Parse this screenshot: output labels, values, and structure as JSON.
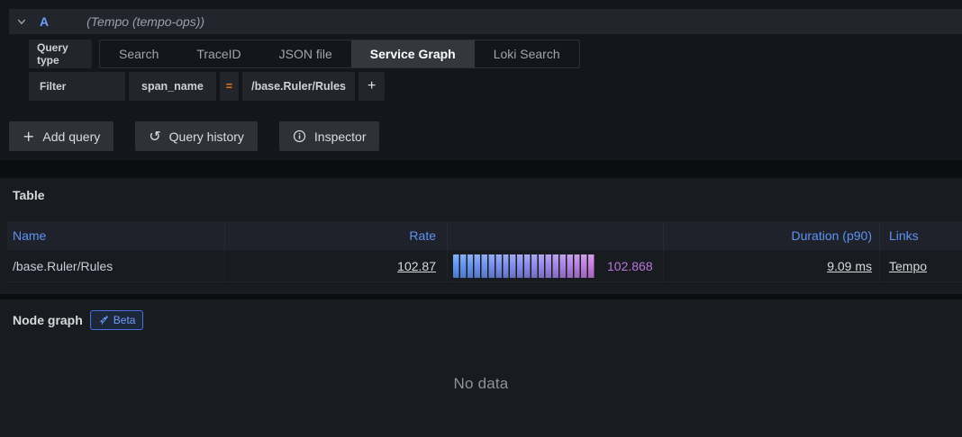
{
  "query_row": {
    "ref_id": "A",
    "datasource": "(Tempo (tempo-ops))",
    "query_type_label": "Query type",
    "tabs": [
      {
        "label": "Search",
        "active": false
      },
      {
        "label": "TraceID",
        "active": false
      },
      {
        "label": "JSON file",
        "active": false
      },
      {
        "label": "Service Graph",
        "active": true
      },
      {
        "label": "Loki Search",
        "active": false
      }
    ],
    "filter": {
      "label": "Filter",
      "field": "span_name",
      "operator": "=",
      "value": "/base.Ruler/Rules",
      "add_label": "+"
    }
  },
  "toolbar": {
    "add_query": "Add query",
    "query_history": "Query history",
    "inspector": "Inspector"
  },
  "table_panel": {
    "title": "Table",
    "columns": [
      "Name",
      "Rate",
      "",
      "Duration (p90)",
      "Links"
    ],
    "rows": [
      {
        "name": "/base.Ruler/Rules",
        "rate": "102.87",
        "rate_gauge_value": "102.868",
        "duration": "9.09 ms",
        "link": "Tempo"
      }
    ]
  },
  "node_graph_panel": {
    "title": "Node graph",
    "badge": "Beta",
    "no_data": "No data"
  },
  "icons": {
    "collapse": "chevron-down-icon",
    "add": "plus-icon",
    "plus_glyph": "+",
    "history": "history-clock-icon",
    "history_glyph": "↺",
    "inspector": "info-circle-icon",
    "beta": "rocket-icon"
  },
  "colors": {
    "page_bg": "#111217",
    "panel_bg": "#181b20",
    "box_bg": "#22252b",
    "accent_blue": "#6e9fff",
    "operator_orange": "#eb7b18",
    "gauge_start": "#5794f2",
    "gauge_end": "#c878dc",
    "gauge_value_text": "#b877d9"
  }
}
